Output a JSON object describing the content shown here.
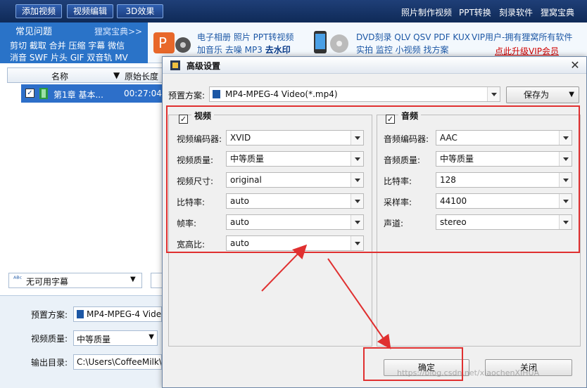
{
  "toolbar": {
    "add_video": "添加视频",
    "edit_video": "视频编辑",
    "effect_3d": "3D效果",
    "links": [
      "照片制作视频",
      "PPT转换",
      "刻录软件",
      "狸窝宝典"
    ]
  },
  "faq": {
    "title": "常见问题",
    "more": "狸窝宝典>>",
    "row1": "剪切 截取 合并 压缩 字幕 微信",
    "row2": "消音 SWF 片头 GIF 双音轨 MV"
  },
  "promo": {
    "line1a": "电子相册 照片 PPT转视频",
    "line1b_prefix": "加音乐 去噪 MP3",
    "line1b_highlight": "去水印",
    "line2a": "DVD刻录 QLV QSV PDF KUX",
    "line2b": "实拍 监控 小视频 找方案",
    "vip_text": "VIP用户-拥有狸窝所有软件",
    "vip_link": "点此升级VIP会员"
  },
  "list": {
    "col_name": "名称",
    "col_length": "原始长度",
    "row_name": "第1章 基本...",
    "row_length": "00:27:04"
  },
  "subtitle_select": "无可用字幕",
  "bottom": {
    "preset_label": "预置方案:",
    "preset_value": "MP4-MPEG-4 Video",
    "quality_label": "视频质量:",
    "quality_value": "中等质量",
    "output_label": "输出目录:",
    "output_value": "C:\\Users\\CoffeeMilk\\D"
  },
  "dialog": {
    "title": "高级设置",
    "preset_label": "预置方案:",
    "preset_value": "MP4-MPEG-4 Video(*.mp4)",
    "save_as": "保存为",
    "video": {
      "header": "视频",
      "fields": [
        {
          "label": "视频编码器:",
          "value": "XVID"
        },
        {
          "label": "视频质量:",
          "value": "中等质量"
        },
        {
          "label": "视频尺寸:",
          "value": "original"
        },
        {
          "label": "比特率:",
          "value": "auto"
        },
        {
          "label": "帧率:",
          "value": "auto"
        },
        {
          "label": "宽高比:",
          "value": "auto"
        }
      ]
    },
    "audio": {
      "header": "音频",
      "fields": [
        {
          "label": "音频编码器:",
          "value": "AAC"
        },
        {
          "label": "音频质量:",
          "value": "中等质量"
        },
        {
          "label": "比特率:",
          "value": "128"
        },
        {
          "label": "采样率:",
          "value": "44100"
        },
        {
          "label": "声道:",
          "value": "stereo"
        }
      ]
    },
    "ok": "确定",
    "close": "关闭"
  },
  "watermark": "https://blog.csdn.net/xiaochenXIHUA",
  "colors": {
    "annotation_red": "#e03030",
    "selection_blue": "#2d6fc9",
    "toolbar_navy": "#1f3f78"
  }
}
